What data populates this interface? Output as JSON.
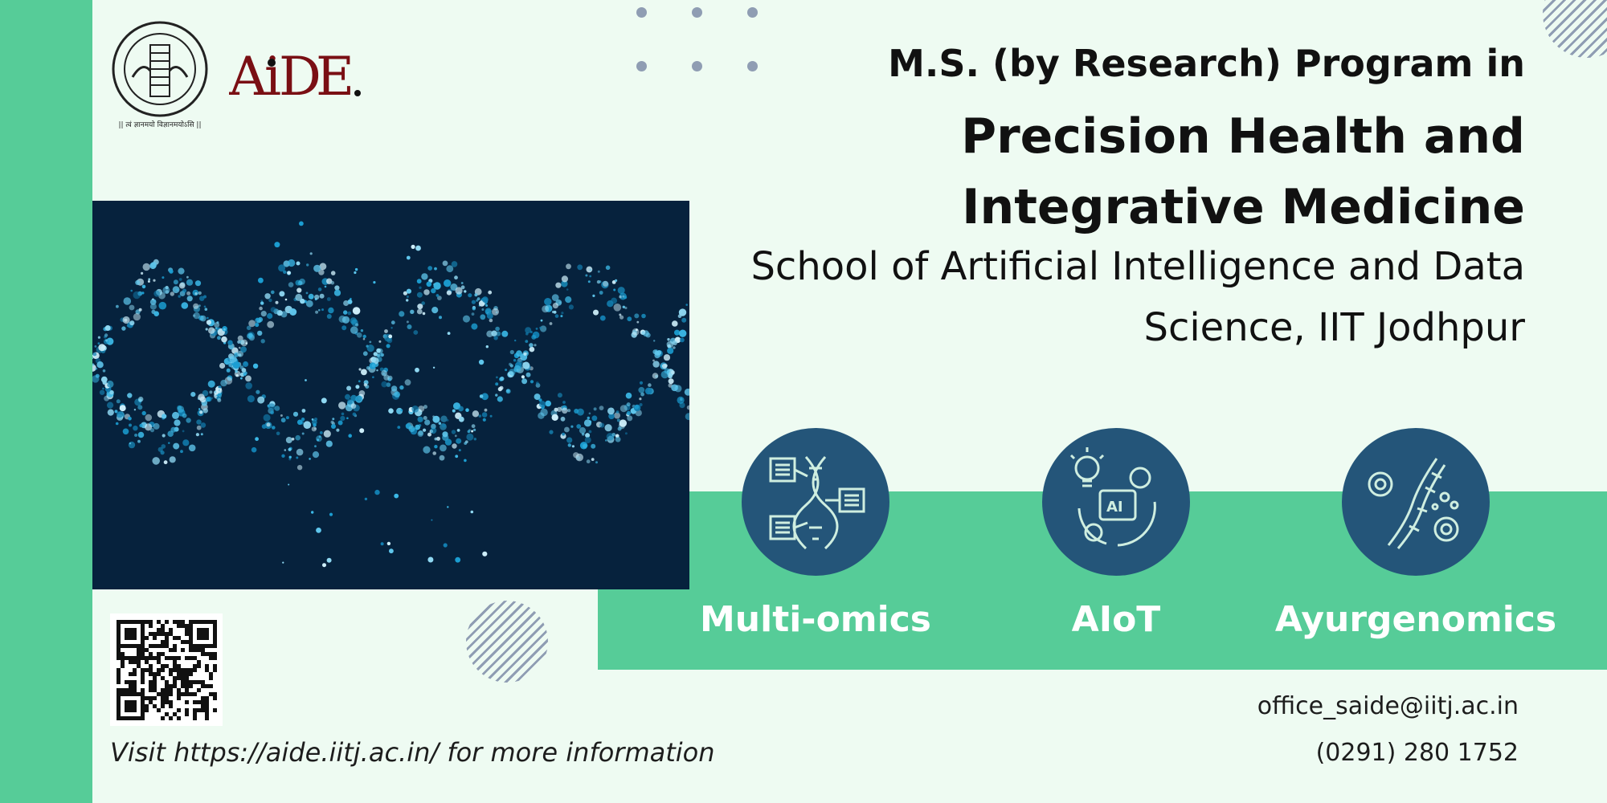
{
  "logos": {
    "iit_motto": "|| त्वं ज्ञानमयो विज्ञानमयोऽसि ||",
    "iit_name": "Indian Institute of Technology Jodhpur",
    "aide_text": "AiDE."
  },
  "heading": {
    "line1": "M.S. (by Research) Program in",
    "line2": "Precision Health and",
    "line3": "Integrative Medicine"
  },
  "school": {
    "line1": "School of Artificial Intelligence and Data",
    "line2": "Science, IIT Jodhpur"
  },
  "areas": [
    {
      "label": "Multi-omics",
      "icon": "dna-data-icon"
    },
    {
      "label": "AIoT",
      "icon": "ai-lightbulb-gear-icon"
    },
    {
      "label": "Ayurgenomics",
      "icon": "dna-gears-icon"
    }
  ],
  "footer": {
    "visit": "Visit https://aide.iitj.ac.in/ for more information",
    "email": "office_saide@iitj.ac.in",
    "phone": "(0291) 280 1752"
  },
  "colors": {
    "background": "#eefbf2",
    "green": "#56cc98",
    "navy_circle": "#245579",
    "dna_bg": "#06223d"
  }
}
